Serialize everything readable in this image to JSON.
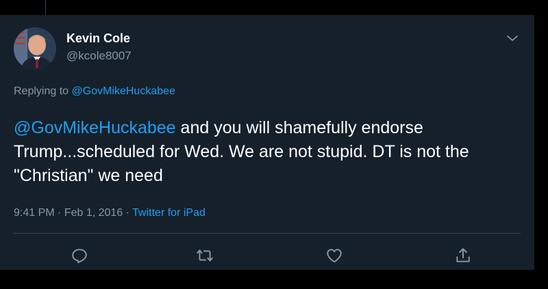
{
  "tweet": {
    "author": {
      "display_name": "Kevin Cole",
      "handle": "@kcole8007"
    },
    "reply": {
      "prefix": "Replying to ",
      "handle": "@GovMikeHuckabee"
    },
    "body": {
      "mention": "@GovMikeHuckabee",
      "text": " and you will shamefully endorse Trump...scheduled for Wed. We are not stupid. DT is not the \"Christian\" we need"
    },
    "meta": {
      "time": "9:41 PM",
      "separator1": " · ",
      "date": "Feb 1, 2016",
      "separator2": " · ",
      "source": "Twitter for iPad"
    },
    "actions": {
      "icons": [
        "reply-icon",
        "retweet-icon",
        "like-icon",
        "share-icon"
      ]
    }
  },
  "colors": {
    "background": "#15202b",
    "link": "#1da1f2",
    "secondary_text": "#8899a6",
    "primary_text": "#ffffff"
  }
}
